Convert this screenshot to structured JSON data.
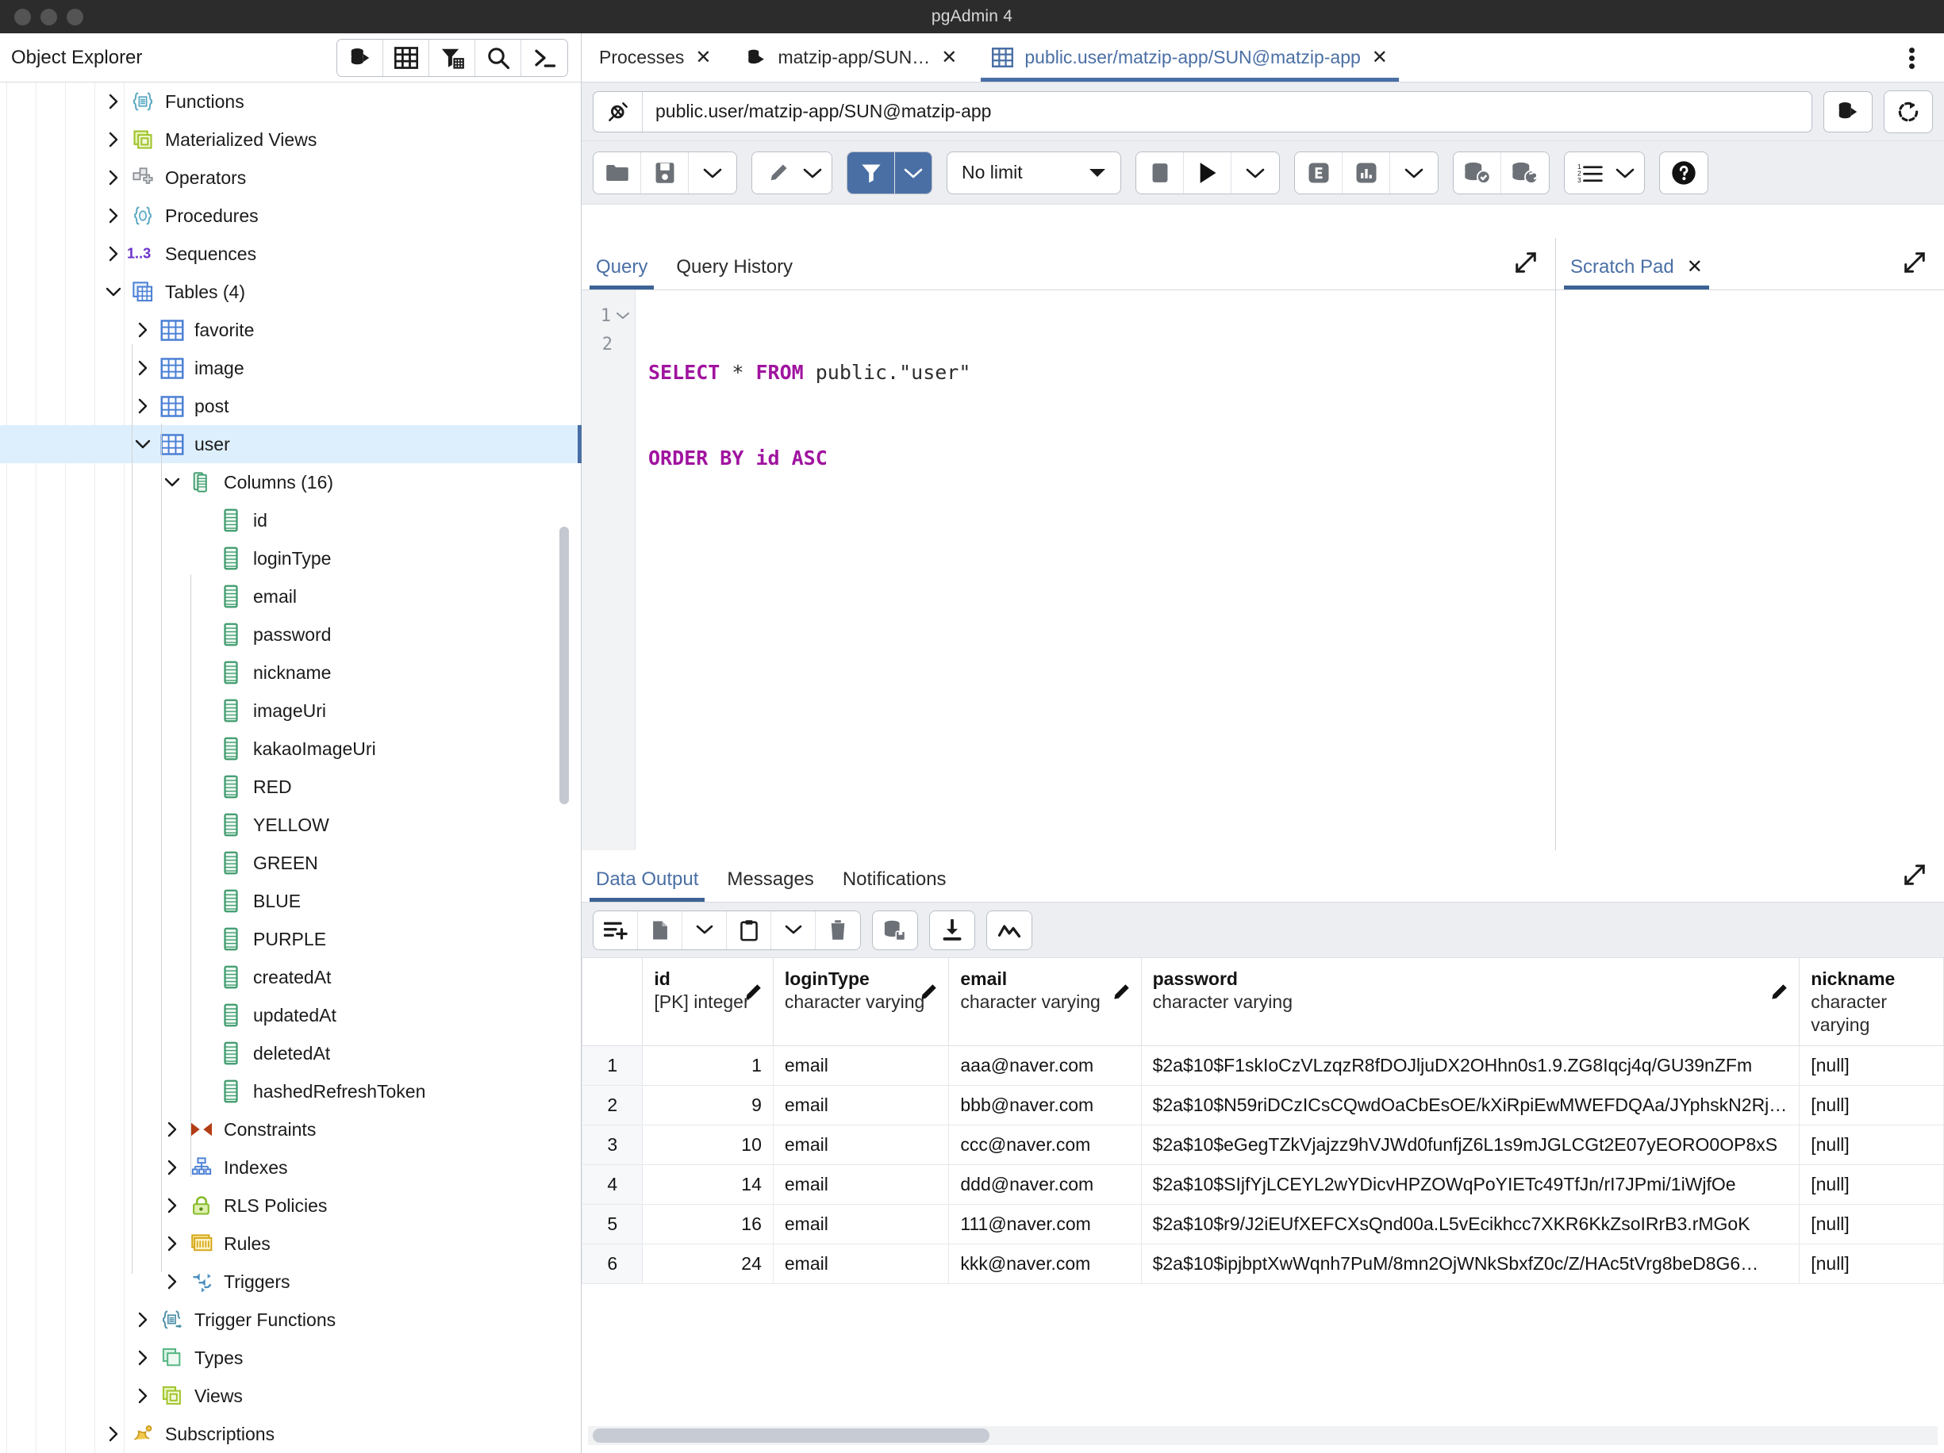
{
  "window": {
    "title": "pgAdmin 4"
  },
  "object_explorer": {
    "title": "Object Explorer",
    "toolbar": [
      {
        "name": "object-explorer-server-icon",
        "label": ""
      },
      {
        "name": "object-explorer-grid-icon",
        "label": ""
      },
      {
        "name": "object-explorer-filter-icon",
        "label": ""
      },
      {
        "name": "object-explorer-search-icon",
        "label": ""
      },
      {
        "name": "object-explorer-terminal-icon",
        "label": ""
      }
    ],
    "tree": [
      {
        "label": "Functions",
        "icon": "functions-icon",
        "indent": 0,
        "state": "collapsed",
        "selected": false
      },
      {
        "label": "Materialized Views",
        "icon": "materialized-view-icon",
        "indent": 0,
        "state": "collapsed",
        "selected": false
      },
      {
        "label": "Operators",
        "icon": "operators-icon",
        "indent": 0,
        "state": "collapsed",
        "selected": false
      },
      {
        "label": "Procedures",
        "icon": "procedures-icon",
        "indent": 0,
        "state": "collapsed",
        "selected": false
      },
      {
        "label": "Sequences",
        "icon": "sequences-icon",
        "indent": 0,
        "state": "collapsed",
        "selected": false
      },
      {
        "label": "Tables (4)",
        "icon": "tables-icon",
        "indent": 0,
        "state": "expanded",
        "selected": false
      },
      {
        "label": "favorite",
        "icon": "table-icon",
        "indent": 1,
        "state": "collapsed",
        "selected": false
      },
      {
        "label": "image",
        "icon": "table-icon",
        "indent": 1,
        "state": "collapsed",
        "selected": false
      },
      {
        "label": "post",
        "icon": "table-icon",
        "indent": 1,
        "state": "collapsed",
        "selected": false
      },
      {
        "label": "user",
        "icon": "table-icon",
        "indent": 1,
        "state": "expanded",
        "selected": true
      },
      {
        "label": "Columns (16)",
        "icon": "columns-icon",
        "indent": 2,
        "state": "expanded",
        "selected": false
      },
      {
        "label": "id",
        "icon": "column-icon",
        "indent": 3,
        "state": "leaf",
        "selected": false
      },
      {
        "label": "loginType",
        "icon": "column-icon",
        "indent": 3,
        "state": "leaf",
        "selected": false
      },
      {
        "label": "email",
        "icon": "column-icon",
        "indent": 3,
        "state": "leaf",
        "selected": false
      },
      {
        "label": "password",
        "icon": "column-icon",
        "indent": 3,
        "state": "leaf",
        "selected": false
      },
      {
        "label": "nickname",
        "icon": "column-icon",
        "indent": 3,
        "state": "leaf",
        "selected": false
      },
      {
        "label": "imageUri",
        "icon": "column-icon",
        "indent": 3,
        "state": "leaf",
        "selected": false
      },
      {
        "label": "kakaoImageUri",
        "icon": "column-icon",
        "indent": 3,
        "state": "leaf",
        "selected": false
      },
      {
        "label": "RED",
        "icon": "column-icon",
        "indent": 3,
        "state": "leaf",
        "selected": false
      },
      {
        "label": "YELLOW",
        "icon": "column-icon",
        "indent": 3,
        "state": "leaf",
        "selected": false
      },
      {
        "label": "GREEN",
        "icon": "column-icon",
        "indent": 3,
        "state": "leaf",
        "selected": false
      },
      {
        "label": "BLUE",
        "icon": "column-icon",
        "indent": 3,
        "state": "leaf",
        "selected": false
      },
      {
        "label": "PURPLE",
        "icon": "column-icon",
        "indent": 3,
        "state": "leaf",
        "selected": false
      },
      {
        "label": "createdAt",
        "icon": "column-icon",
        "indent": 3,
        "state": "leaf",
        "selected": false
      },
      {
        "label": "updatedAt",
        "icon": "column-icon",
        "indent": 3,
        "state": "leaf",
        "selected": false
      },
      {
        "label": "deletedAt",
        "icon": "column-icon",
        "indent": 3,
        "state": "leaf",
        "selected": false
      },
      {
        "label": "hashedRefreshToken",
        "icon": "column-icon",
        "indent": 3,
        "state": "leaf",
        "selected": false
      },
      {
        "label": "Constraints",
        "icon": "constraints-icon",
        "indent": 2,
        "state": "collapsed",
        "selected": false
      },
      {
        "label": "Indexes",
        "icon": "indexes-icon",
        "indent": 2,
        "state": "collapsed",
        "selected": false
      },
      {
        "label": "RLS Policies",
        "icon": "rls-policies-icon",
        "indent": 2,
        "state": "collapsed",
        "selected": false
      },
      {
        "label": "Rules",
        "icon": "rules-icon",
        "indent": 2,
        "state": "collapsed",
        "selected": false
      },
      {
        "label": "Triggers",
        "icon": "triggers-icon",
        "indent": 2,
        "state": "collapsed",
        "selected": false
      },
      {
        "label": "Trigger Functions",
        "icon": "trigger-functions-icon",
        "indent": 1,
        "state": "collapsed",
        "selected": false
      },
      {
        "label": "Types",
        "icon": "types-icon",
        "indent": 1,
        "state": "collapsed",
        "selected": false
      },
      {
        "label": "Views",
        "icon": "views-icon",
        "indent": 1,
        "state": "collapsed",
        "selected": false
      },
      {
        "label": "Subscriptions",
        "icon": "subscriptions-icon",
        "indent": 0,
        "state": "collapsed",
        "selected": false
      }
    ]
  },
  "workspace_tabs": [
    {
      "label": "Processes",
      "icon": null,
      "active": false,
      "closable": true
    },
    {
      "label": "matzip-app/SUN…",
      "icon": "server-icon",
      "active": false,
      "closable": true
    },
    {
      "label": "public.user/matzip-app/SUN@matzip-app",
      "icon": "table-icon",
      "active": true,
      "closable": true
    }
  ],
  "connection_bar": {
    "value": "public.user/matzip-app/SUN@matzip-app",
    "connect_icon": "connection-icon",
    "database_icon": "database-selector-icon",
    "reset_icon": "reset-layout-icon"
  },
  "query_toolbar": {
    "open_file_icon": "open-file-icon",
    "save_file_icon": "save-file-icon",
    "save_dropdown_icon": "chevron-down-icon",
    "edit_icon": "edit-pencil-icon",
    "edit_dropdown_icon": "chevron-down-icon",
    "filter_icon": "filter-icon",
    "filter_dropdown_icon": "chevron-down-icon",
    "row_limit_label": "No limit",
    "row_limit_caret": "chevron-down-icon",
    "stop_icon": "stop-icon",
    "execute_icon": "play-icon",
    "execute_dropdown_icon": "chevron-down-icon",
    "explain_icon": "explain-icon",
    "explain_analyze_icon": "explain-analyze-icon",
    "explain_dropdown_icon": "chevron-down-icon",
    "commit_icon": "commit-icon",
    "rollback_icon": "rollback-icon",
    "macros_icon": "macros-icon",
    "macros_dropdown_icon": "chevron-down-icon",
    "help_icon": "help-icon"
  },
  "query_pane": {
    "tabs": [
      {
        "label": "Query",
        "active": true
      },
      {
        "label": "Query History",
        "active": false
      }
    ],
    "expand_icon": "expand-icon",
    "lines": [
      {
        "number": "1",
        "foldable": true,
        "tokens": [
          {
            "t": "SELECT",
            "c": "kw"
          },
          {
            "t": " * ",
            "c": "pl"
          },
          {
            "t": "FROM",
            "c": "kw"
          },
          {
            "t": " public.\"user\"",
            "c": "pl"
          }
        ]
      },
      {
        "number": "2",
        "foldable": false,
        "tokens": [
          {
            "t": "ORDER BY id ASC",
            "c": "kw"
          }
        ]
      }
    ],
    "sql_text": "SELECT * FROM public.\"user\"\nORDER BY id ASC"
  },
  "scratch_pad": {
    "tab_label": "Scratch Pad",
    "close_icon": "close-icon",
    "expand_icon": "expand-icon",
    "content": ""
  },
  "output_pane": {
    "tabs": [
      {
        "label": "Data Output",
        "active": true
      },
      {
        "label": "Messages",
        "active": false
      },
      {
        "label": "Notifications",
        "active": false
      }
    ],
    "expand_icon": "expand-icon",
    "toolbar": {
      "add_row_icon": "add-row-icon",
      "copy_icon": "copy-icon",
      "copy_dropdown_icon": "chevron-down-icon",
      "paste_icon": "paste-icon",
      "paste_dropdown_icon": "chevron-down-icon",
      "delete_icon": "delete-row-icon",
      "save_data_icon": "save-data-changes-icon",
      "download_icon": "download-csv-icon",
      "graph_icon": "graph-visualiser-icon"
    },
    "columns": [
      {
        "name": "id",
        "type": "[PK] integer",
        "editable": true
      },
      {
        "name": "loginType",
        "type": "character varying",
        "editable": true
      },
      {
        "name": "email",
        "type": "character varying",
        "editable": true
      },
      {
        "name": "password",
        "type": "character varying",
        "editable": true
      },
      {
        "name": "nickname",
        "type": "character varying",
        "editable": true
      }
    ],
    "rows": [
      {
        "n": "1",
        "id": "1",
        "loginType": "email",
        "email": "aaa@naver.com",
        "password": "$2a$10$F1skIoCzVLzqzR8fDOJljuDX2OHhn0s1.9.ZG8Iqcj4q/GU39nZFm",
        "nickname": "[null]"
      },
      {
        "n": "2",
        "id": "9",
        "loginType": "email",
        "email": "bbb@naver.com",
        "password": "$2a$10$N59riDCzICsCQwdOaCbEsOE/kXiRpiEwMWEFDQAa/JYphskN2Rj…",
        "nickname": "[null]"
      },
      {
        "n": "3",
        "id": "10",
        "loginType": "email",
        "email": "ccc@naver.com",
        "password": "$2a$10$eGegTZkVjajzz9hVJWd0funfjZ6L1s9mJGLCGt2E07yEORO0OP8xS",
        "nickname": "[null]"
      },
      {
        "n": "4",
        "id": "14",
        "loginType": "email",
        "email": "ddd@naver.com",
        "password": "$2a$10$SIjfYjLCEYL2wYDicvHPZOWqPoYIETc49TfJn/rI7JPmi/1iWjfOe",
        "nickname": "[null]"
      },
      {
        "n": "5",
        "id": "16",
        "loginType": "email",
        "email": "111@naver.com",
        "password": "$2a$10$r9/J2iEUfXEFCXsQnd00a.L5vEcikhcc7XKR6KkZsoIRrB3.rMGoK",
        "nickname": "[null]"
      },
      {
        "n": "6",
        "id": "24",
        "loginType": "email",
        "email": "kkk@naver.com",
        "password": "$2a$10$ipjbptXwWqnh7PuM/8mn2OjWNkSbxfZ0c/Z/HAc5tVrg8beD8G6…",
        "nickname": "[null]"
      }
    ]
  },
  "colors": {
    "titlebar": "#2c2c2c",
    "accent": "#4a6fa5",
    "selection": "#ddeffc",
    "toolbar_bg": "#eceef2",
    "sql_keyword": "#a0139f"
  }
}
